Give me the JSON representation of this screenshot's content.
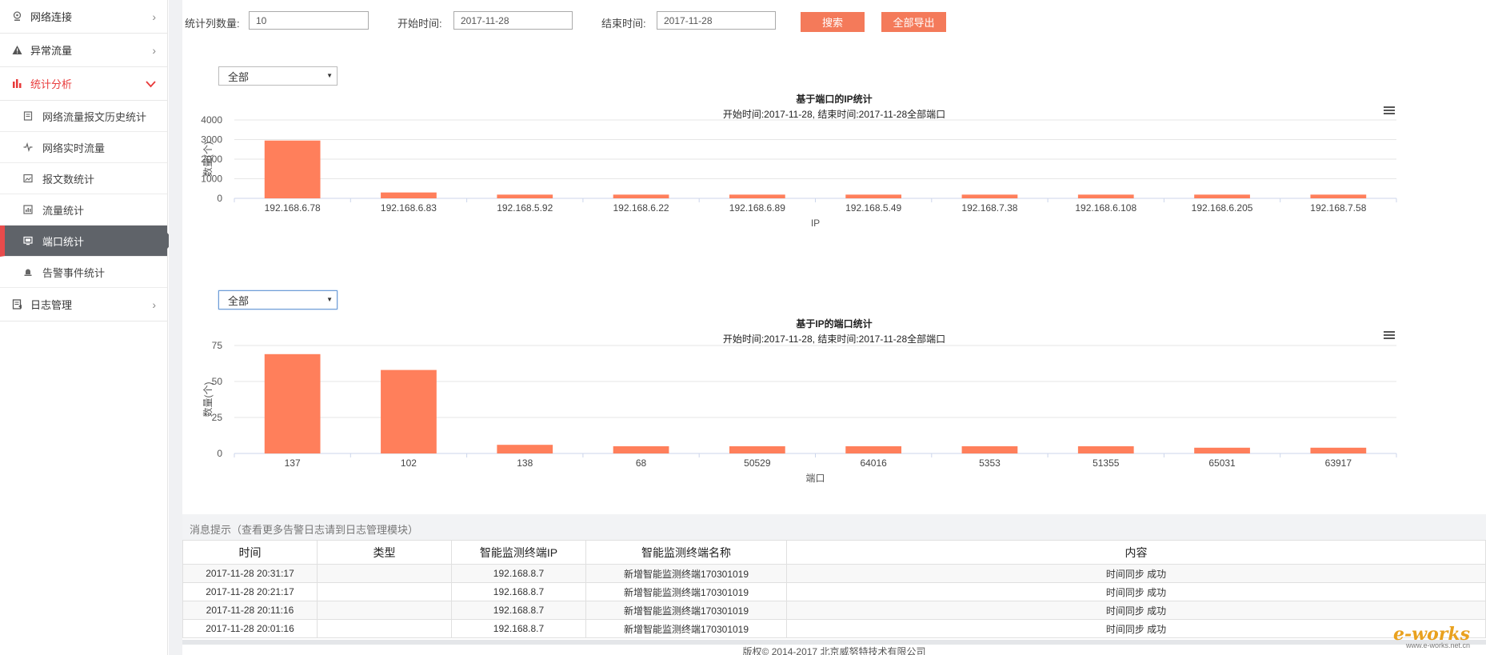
{
  "sidebar": {
    "items": [
      {
        "label": "网络连接",
        "icon": "network-icon"
      },
      {
        "label": "异常流量",
        "icon": "warning-icon"
      },
      {
        "label": "统计分析",
        "icon": "bar-chart-icon"
      }
    ],
    "subitems": [
      {
        "label": "网络流量报文历史统计",
        "icon": "document-icon"
      },
      {
        "label": "网络实时流量",
        "icon": "pulse-icon"
      },
      {
        "label": "报文数统计",
        "icon": "image-icon"
      },
      {
        "label": "流量统计",
        "icon": "chart-icon"
      },
      {
        "label": "端口统计",
        "icon": "monitor-icon"
      },
      {
        "label": "告警事件统计",
        "icon": "alarm-icon"
      }
    ],
    "log_item": {
      "label": "日志管理",
      "icon": "log-icon"
    }
  },
  "filters": {
    "count_label": "统计列数量:",
    "count_value": "10",
    "start_label": "开始时间:",
    "start_value": "2017-11-28",
    "end_label": "结束时间:",
    "end_value": "2017-11-28",
    "search_label": "搜索",
    "export_label": "全部导出"
  },
  "selects": {
    "chart1": "全部",
    "chart2": "全部"
  },
  "chart_data": [
    {
      "type": "bar",
      "title": "基于端口的IP统计",
      "subtitle": "开始时间:2017-11-28, 结束时间:2017-11-28全部端口",
      "xlabel": "IP",
      "ylabel": "数量(个)",
      "ylim": [
        0,
        4000
      ],
      "yticks": [
        0,
        1000,
        2000,
        3000,
        4000
      ],
      "categories": [
        "192.168.6.78",
        "192.168.6.83",
        "192.168.5.92",
        "192.168.6.22",
        "192.168.6.89",
        "192.168.5.49",
        "192.168.7.38",
        "192.168.6.108",
        "192.168.6.205",
        "192.168.7.58"
      ],
      "values": [
        2950,
        300,
        190,
        190,
        190,
        190,
        190,
        190,
        190,
        190
      ],
      "color": "#ff7f5b",
      "grid": true
    },
    {
      "type": "bar",
      "title": "基于IP的端口统计",
      "subtitle": "开始时间:2017-11-28, 结束时间:2017-11-28全部端口",
      "xlabel": "端口",
      "ylabel": "数量(个)",
      "ylim": [
        0,
        75
      ],
      "yticks": [
        0,
        25,
        50,
        75
      ],
      "categories": [
        "137",
        "102",
        "138",
        "68",
        "50529",
        "64016",
        "5353",
        "51355",
        "65031",
        "63917"
      ],
      "values": [
        69,
        58,
        6,
        5,
        5,
        5,
        5,
        5,
        4,
        4
      ],
      "color": "#ff7f5b",
      "grid": true
    }
  ],
  "messages": {
    "title": "消息提示（查看更多告警日志请到日志管理模块）",
    "headers": [
      "时间",
      "类型",
      "智能监测终端IP",
      "智能监测终端名称",
      "内容"
    ],
    "rows": [
      [
        "2017-11-28 20:31:17",
        "",
        "192.168.8.7",
        "新增智能监测终端170301019",
        "时间同步 成功"
      ],
      [
        "2017-11-28 20:21:17",
        "",
        "192.168.8.7",
        "新增智能监测终端170301019",
        "时间同步 成功"
      ],
      [
        "2017-11-28 20:11:16",
        "",
        "192.168.8.7",
        "新增智能监测终端170301019",
        "时间同步 成功"
      ],
      [
        "2017-11-28 20:01:16",
        "",
        "192.168.8.7",
        "新增智能监测终端170301019",
        "时间同步 成功"
      ]
    ]
  },
  "footer": "版权© 2014-2017 北京威努特技术有限公司",
  "brand": {
    "name": "e-works",
    "domain": "www.e-works.net.cn"
  }
}
